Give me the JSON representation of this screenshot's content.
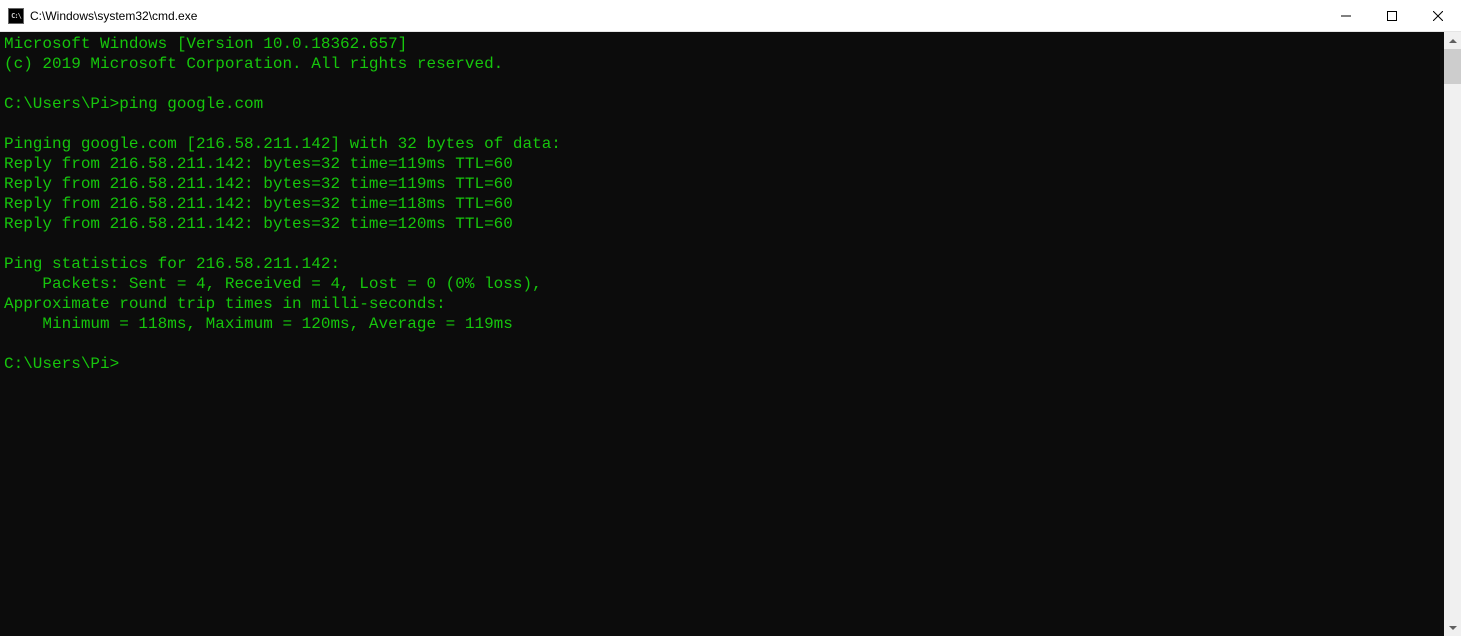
{
  "window": {
    "title": "C:\\Windows\\system32\\cmd.exe",
    "icon_label": "C:\\"
  },
  "terminal": {
    "banner_version": "Microsoft Windows [Version 10.0.18362.657]",
    "banner_copyright": "(c) 2019 Microsoft Corporation. All rights reserved.",
    "prompt1": "C:\\Users\\Pi>ping google.com",
    "ping_header": "Pinging google.com [216.58.211.142] with 32 bytes of data:",
    "reply1": "Reply from 216.58.211.142: bytes=32 time=119ms TTL=60",
    "reply2": "Reply from 216.58.211.142: bytes=32 time=119ms TTL=60",
    "reply3": "Reply from 216.58.211.142: bytes=32 time=118ms TTL=60",
    "reply4": "Reply from 216.58.211.142: bytes=32 time=120ms TTL=60",
    "stats_header": "Ping statistics for 216.58.211.142:",
    "stats_packets": "    Packets: Sent = 4, Received = 4, Lost = 0 (0% loss),",
    "stats_rtt_header": "Approximate round trip times in milli-seconds:",
    "stats_rtt": "    Minimum = 118ms, Maximum = 120ms, Average = 119ms",
    "prompt2": "C:\\Users\\Pi>"
  }
}
